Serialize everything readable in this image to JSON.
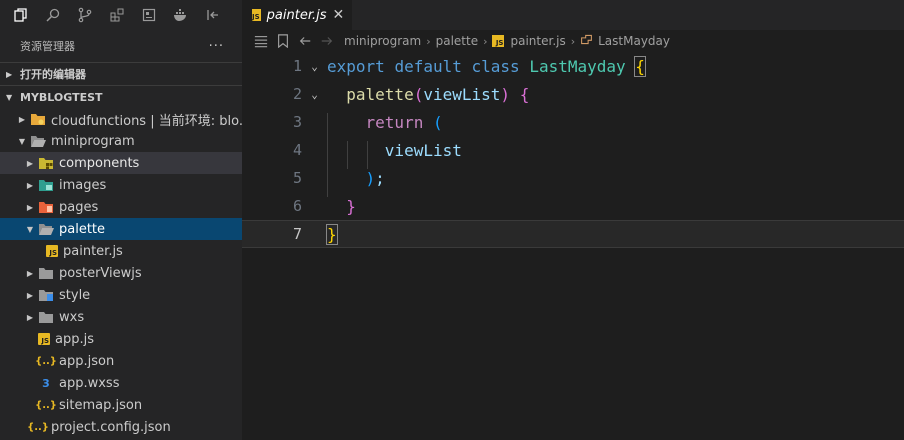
{
  "sidebar": {
    "title": "资源管理器",
    "more": "···",
    "open_editors": "打开的编辑器",
    "project": "MYBLOGTEST",
    "tree": [
      {
        "label": "cloudfunctions | 当前环境: blo...",
        "icon": "cloud-folder-icon"
      },
      {
        "label": "miniprogram",
        "icon": "folder-open-icon"
      },
      {
        "label": "components",
        "icon": "components-folder-icon"
      },
      {
        "label": "images",
        "icon": "images-folder-icon"
      },
      {
        "label": "pages",
        "icon": "pages-folder-icon"
      },
      {
        "label": "palette",
        "icon": "folder-open-icon"
      },
      {
        "label": "painter.js",
        "icon": "js-file-icon"
      },
      {
        "label": "posterViewjs",
        "icon": "folder-icon"
      },
      {
        "label": "style",
        "icon": "style-folder-icon"
      },
      {
        "label": "wxs",
        "icon": "folder-icon"
      },
      {
        "label": "app.js",
        "icon": "js-file-icon"
      },
      {
        "label": "app.json",
        "icon": "json-file-icon"
      },
      {
        "label": "app.wxss",
        "icon": "css-file-icon"
      },
      {
        "label": "sitemap.json",
        "icon": "json-file-icon"
      },
      {
        "label": "project.config.json",
        "icon": "json-file-icon"
      }
    ],
    "file_badge": "JS",
    "json_glyph": "{..}",
    "css_glyph": "3"
  },
  "tab": {
    "label": "painter.js",
    "close": "✕",
    "badge": "JS"
  },
  "breadcrumb": [
    "miniprogram",
    "palette",
    "painter.js",
    "LastMayday"
  ],
  "editor": {
    "line_numbers": [
      "1",
      "2",
      "3",
      "4",
      "5",
      "6",
      "7"
    ],
    "tokens": {
      "export": "export",
      "default": "default",
      "class": "class",
      "classname": "LastMayday",
      "open_brace": "{",
      "method": "palette",
      "paren_open": "(",
      "param": "viewList",
      "paren_close": ")",
      "method_brace": "{",
      "return": "return",
      "ret_paren_open": "(",
      "ret_value": "viewList",
      "ret_paren_close": ")",
      "semicolon": ";",
      "method_close": "}",
      "class_close": "}"
    }
  },
  "colors": {
    "accent": "#094771",
    "keyword": "#569cd6",
    "class": "#4ec9b0",
    "function": "#dcdcaa",
    "variable": "#9cdcfe"
  }
}
